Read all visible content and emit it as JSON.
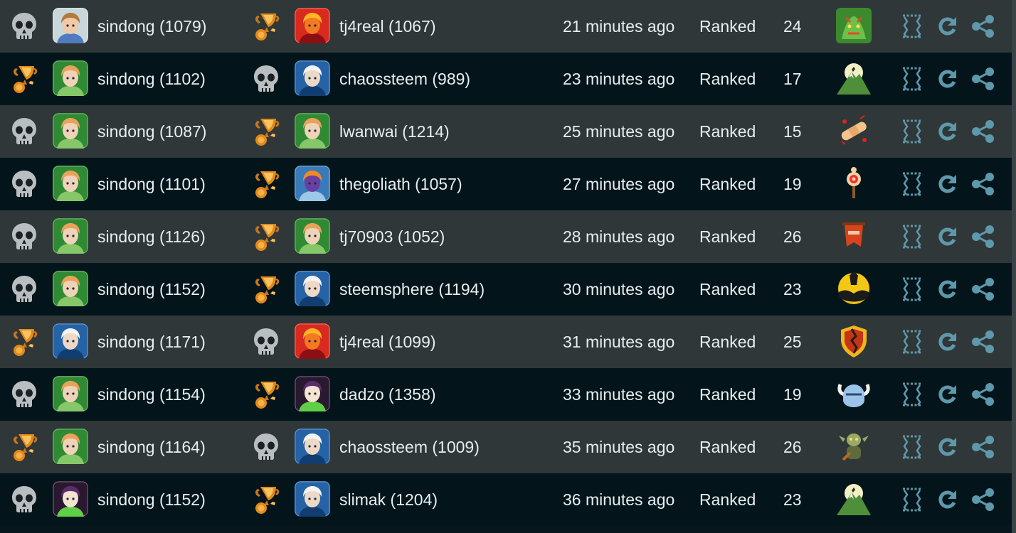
{
  "colors": {
    "row_odd": "#303738",
    "row_even": "#03151b",
    "text": "#e8eef0",
    "action_icon": "#5e98ab",
    "skull": "#b9bfc1",
    "trophy": "#e2891c"
  },
  "battles": [
    {
      "p1_result": "loss",
      "p1_avatar": "blonde-hero-avatar",
      "p1_name": "sindong (1079)",
      "p2_result": "win",
      "p2_avatar": "red-dragon-avatar",
      "p2_name": "tj4real (1067)",
      "time": "21 minutes ago",
      "mode": "Ranked",
      "mana": "24",
      "ruleset": "green-dragon-ruleset-icon"
    },
    {
      "p1_result": "win",
      "p1_avatar": "green-elf-avatar",
      "p1_name": "sindong (1102)",
      "p2_result": "loss",
      "p2_avatar": "blue-wizard-avatar",
      "p2_name": "chaossteem (989)",
      "time": "23 minutes ago",
      "mode": "Ranked",
      "mana": "17",
      "ruleset": "mountain-moon-ruleset-icon"
    },
    {
      "p1_result": "loss",
      "p1_avatar": "green-elf-avatar",
      "p1_name": "sindong (1087)",
      "p2_result": "win",
      "p2_avatar": "green-elf-avatar",
      "p2_name": "lwanwai (1214)",
      "time": "25 minutes ago",
      "mode": "Ranked",
      "mana": "15",
      "ruleset": "bandage-ruleset-icon"
    },
    {
      "p1_result": "loss",
      "p1_avatar": "green-elf-avatar",
      "p1_name": "sindong (1101)",
      "p2_result": "win",
      "p2_avatar": "blue-dragon-avatar",
      "p2_name": "thegoliath (1057)",
      "time": "27 minutes ago",
      "mode": "Ranked",
      "mana": "19",
      "ruleset": "target-dummy-ruleset-icon"
    },
    {
      "p1_result": "loss",
      "p1_avatar": "green-elf-avatar",
      "p1_name": "sindong (1126)",
      "p2_result": "win",
      "p2_avatar": "green-elf-avatar",
      "p2_name": "tj70903 (1052)",
      "time": "28 minutes ago",
      "mode": "Ranked",
      "mana": "26",
      "ruleset": "banner-ruleset-icon"
    },
    {
      "p1_result": "loss",
      "p1_avatar": "green-elf-avatar",
      "p1_name": "sindong (1152)",
      "p2_result": "win",
      "p2_avatar": "blue-wizard-avatar",
      "p2_name": "steemsphere (1194)",
      "time": "30 minutes ago",
      "mode": "Ranked",
      "mana": "23",
      "ruleset": "dark-moon-ruleset-icon"
    },
    {
      "p1_result": "win",
      "p1_avatar": "blue-wizard-avatar",
      "p1_name": "sindong (1171)",
      "p2_result": "loss",
      "p2_avatar": "red-dragon-avatar",
      "p2_name": "tj4real (1099)",
      "time": "31 minutes ago",
      "mode": "Ranked",
      "mana": "25",
      "ruleset": "broken-shield-ruleset-icon"
    },
    {
      "p1_result": "loss",
      "p1_avatar": "green-elf-avatar",
      "p1_name": "sindong (1154)",
      "p2_result": "win",
      "p2_avatar": "dark-lord-avatar",
      "p2_name": "dadzo (1358)",
      "time": "33 minutes ago",
      "mode": "Ranked",
      "mana": "19",
      "ruleset": "horned-helmet-ruleset-icon"
    },
    {
      "p1_result": "win",
      "p1_avatar": "green-elf-avatar",
      "p1_name": "sindong (1164)",
      "p2_result": "loss",
      "p2_avatar": "blue-wizard-avatar",
      "p2_name": "chaossteem (1009)",
      "time": "35 minutes ago",
      "mode": "Ranked",
      "mana": "26",
      "ruleset": "goblin-ruleset-icon"
    },
    {
      "p1_result": "loss",
      "p1_avatar": "dark-lord-avatar",
      "p1_name": "sindong (1152)",
      "p2_result": "win",
      "p2_avatar": "blue-wizard-avatar",
      "p2_name": "slimak (1204)",
      "time": "36 minutes ago",
      "mode": "Ranked",
      "mana": "23",
      "ruleset": "mountain-moon-ruleset-icon"
    }
  ],
  "actions": {
    "cards_icon": "cards-icon",
    "rematch_icon": "rematch-icon",
    "share_icon": "share-icon"
  }
}
